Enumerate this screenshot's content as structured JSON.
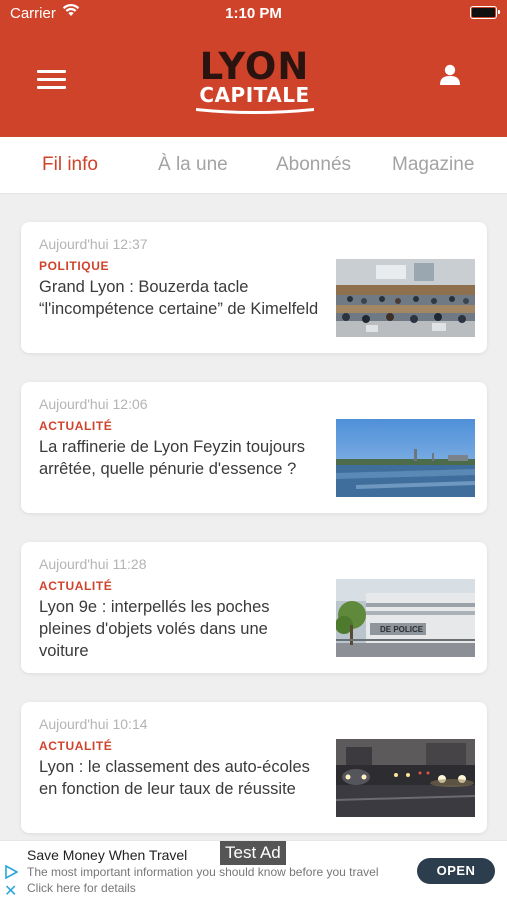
{
  "status_bar": {
    "carrier": "Carrier",
    "time": "1:10 PM"
  },
  "header": {
    "logo_line1": "LYON",
    "logo_line2": "CAPITALE"
  },
  "tabs": [
    {
      "label": "Fil info",
      "active": true
    },
    {
      "label": "À la une",
      "active": false
    },
    {
      "label": "Abonnés",
      "active": false
    },
    {
      "label": "Magazine",
      "active": false
    }
  ],
  "articles": [
    {
      "time": "Aujourd'hui 12:37",
      "category": "POLITIQUE",
      "title": "Grand Lyon : Bouzerda tacle “l'incompétence certaine” de Kimelfeld",
      "thumbnail": "council-chamber-photo"
    },
    {
      "time": "Aujourd'hui 12:06",
      "category": "ACTUALITÉ",
      "title": "La raffinerie de Lyon Feyzin toujours arrêtée, quelle pénurie d'essence ?",
      "thumbnail": "river-refinery-photo"
    },
    {
      "time": "Aujourd'hui 11:28",
      "category": "ACTUALITÉ",
      "title": "Lyon 9e : interpellés les poches pleines d'objets volés dans une voiture",
      "thumbnail": "police-station-photo",
      "thumb_sign": "DE POLICE"
    },
    {
      "time": "Aujourd'hui 10:14",
      "category": "ACTUALITÉ",
      "title": "Lyon : le classement des auto-écoles en fonction de leur taux de réussite",
      "thumbnail": "traffic-night-photo"
    }
  ],
  "ad": {
    "tag": "Test Ad",
    "title": "Save Money When Travel",
    "body": "The most important information you should know before you travel",
    "cta_text": "Click here for details",
    "button": "OPEN"
  },
  "colors": {
    "brand": "#d0432b",
    "ad_button": "#2c3e4e",
    "inactive_tab": "#a3a3a3"
  }
}
